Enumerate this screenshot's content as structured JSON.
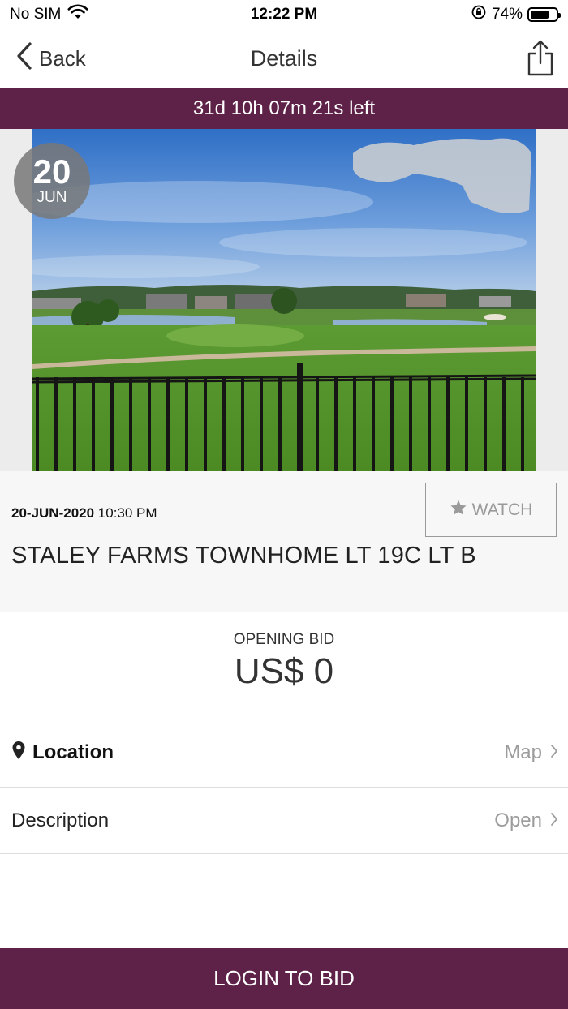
{
  "status_bar": {
    "carrier": "No SIM",
    "time": "12:22 PM",
    "battery_percent": "74%",
    "battery_level": 0.74
  },
  "nav": {
    "back_label": "Back",
    "title": "Details"
  },
  "timer": {
    "text": "31d 10h 07m 21s left"
  },
  "date_badge": {
    "day": "20",
    "month": "JUN"
  },
  "auction": {
    "date": "20-JUN-2020",
    "time": "10:30 PM",
    "title": "STALEY FARMS TOWNHOME LT 19C LT B",
    "watch_label": "WATCH"
  },
  "bid": {
    "label": "OPENING BID",
    "value": "US$ 0"
  },
  "rows": {
    "location": {
      "label": "Location",
      "action": "Map"
    },
    "description": {
      "label": "Description",
      "action": "Open"
    }
  },
  "login_button": {
    "label": "LOGIN TO BID"
  },
  "colors": {
    "brand": "#5e2148",
    "muted": "#9c9c9c"
  },
  "icons": [
    "wifi-icon",
    "orientation-lock-icon",
    "battery-icon",
    "chevron-left-icon",
    "share-icon",
    "star-icon",
    "location-pin-icon",
    "chevron-right-icon"
  ]
}
